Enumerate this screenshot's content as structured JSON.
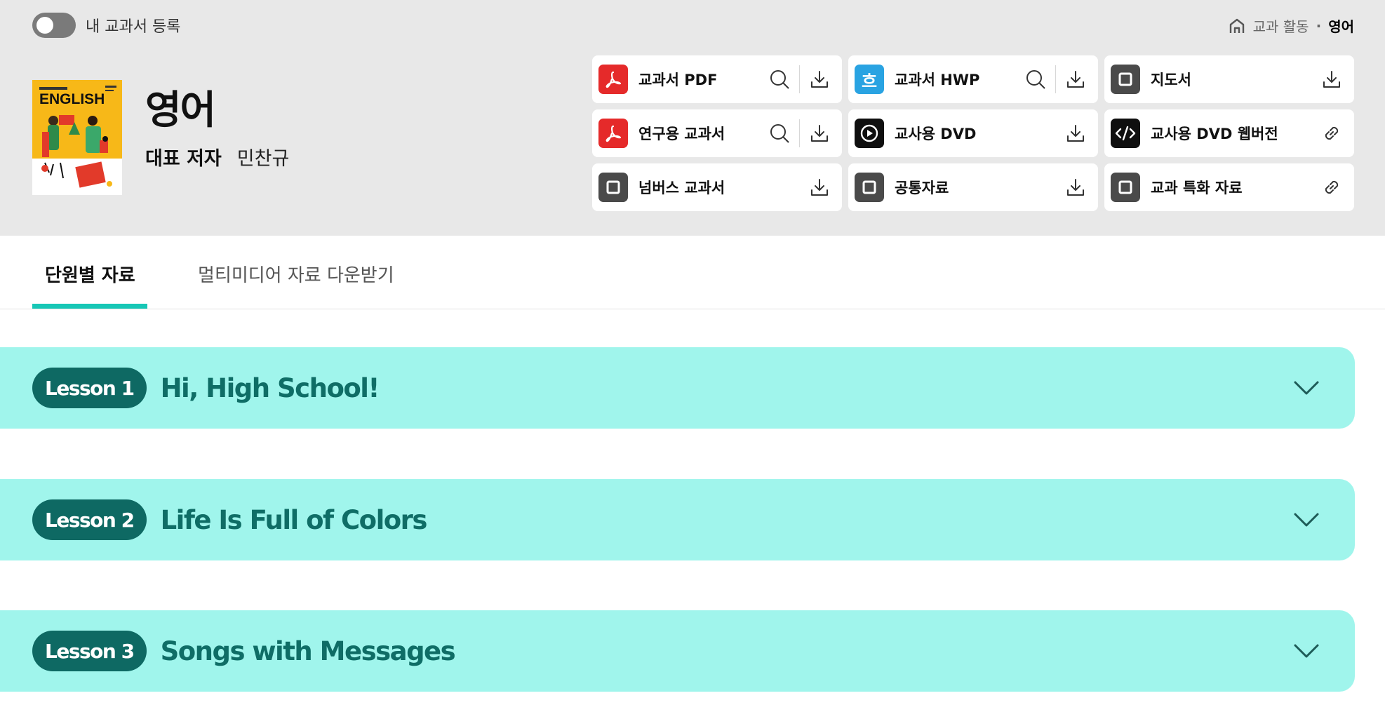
{
  "header": {
    "register_toggle_label": "내 교과서 등록",
    "breadcrumb": {
      "section": "교과 활동",
      "separator": "·",
      "current": "영어"
    },
    "subject": "영어",
    "author_label": "대표 저자",
    "author_name": "민찬규",
    "cover_text": "ENGLISH"
  },
  "resources": [
    {
      "label": "교과서 PDF",
      "icon": "pdf-icon",
      "actions": [
        "search",
        "download"
      ]
    },
    {
      "label": "교과서 HWP",
      "icon": "hwp-icon",
      "actions": [
        "search",
        "download"
      ]
    },
    {
      "label": "지도서",
      "icon": "square-icon",
      "actions": [
        "download"
      ]
    },
    {
      "label": "연구용 교과서",
      "icon": "pdf-icon",
      "actions": [
        "search",
        "download"
      ]
    },
    {
      "label": "교사용 DVD",
      "icon": "play-icon",
      "actions": [
        "download"
      ]
    },
    {
      "label": "교사용 DVD 웹버전",
      "icon": "code-icon",
      "actions": [
        "link"
      ]
    },
    {
      "label": "넘버스 교과서",
      "icon": "square-icon",
      "actions": [
        "download"
      ]
    },
    {
      "label": "공통자료",
      "icon": "square-icon",
      "actions": [
        "download"
      ]
    },
    {
      "label": "교과 특화 자료",
      "icon": "square-icon",
      "actions": [
        "link"
      ]
    }
  ],
  "hwp_glyph": "흐",
  "tabs": [
    {
      "label": "단원별 자료",
      "active": true
    },
    {
      "label": "멀티미디어 자료 다운받기",
      "active": false
    }
  ],
  "lessons": [
    {
      "badge": "Lesson 1",
      "title": "Hi, High School!"
    },
    {
      "badge": "Lesson 2",
      "title": "Life Is Full of Colors"
    },
    {
      "badge": "Lesson 3",
      "title": "Songs with Messages"
    }
  ],
  "colors": {
    "accent": "#17c7b6",
    "lesson_bg": "#a0f5ec",
    "lesson_badge": "#0e6963",
    "lesson_title": "#0f6d66",
    "pdf": "#e52a2a",
    "hwp": "#29a3e2"
  }
}
